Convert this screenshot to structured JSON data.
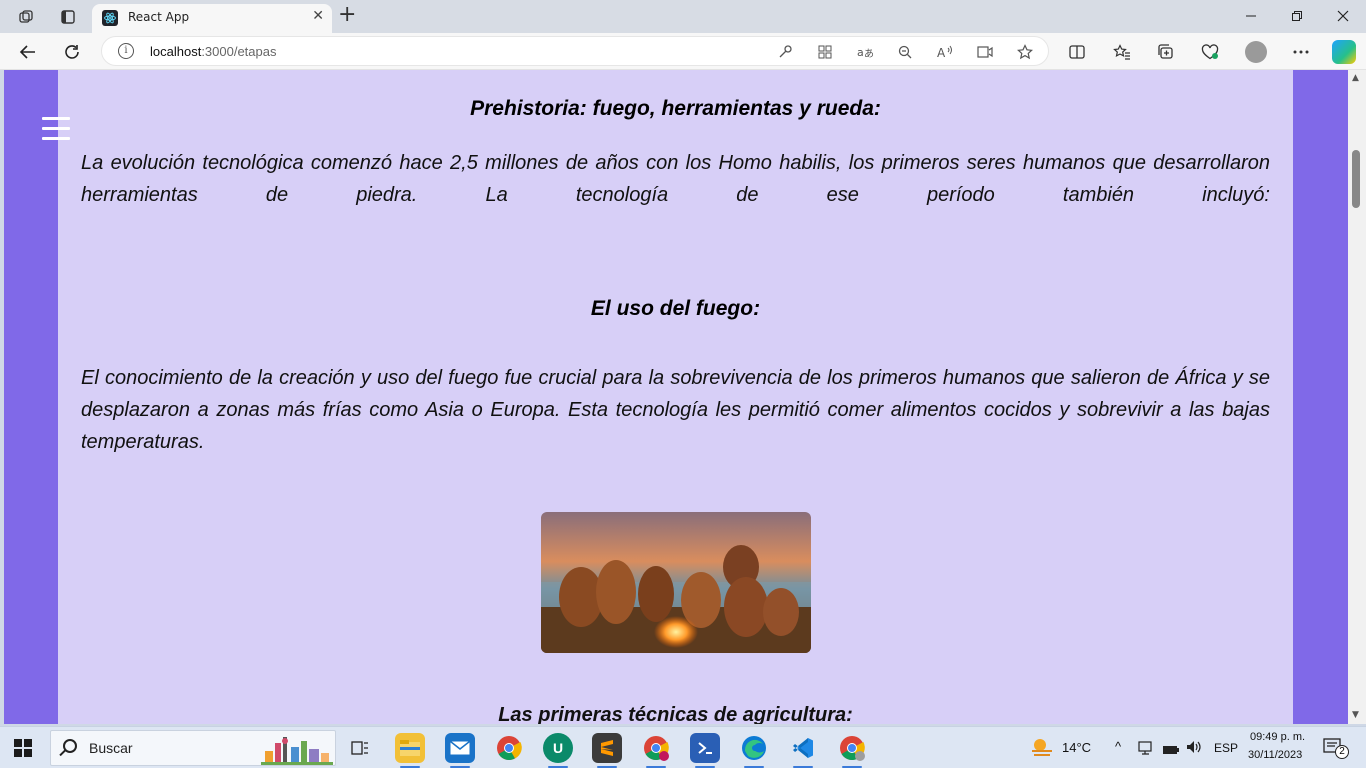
{
  "browser": {
    "tab_title": "React App",
    "new_tab_symbol": "+",
    "close_tab_symbol": "✕",
    "address_host": "localhost",
    "address_path": ":3000/etapas"
  },
  "page": {
    "heading": "Prehistoria: fuego, herramientas y rueda:",
    "intro": "La evolución tecnológica comenzó hace 2,5 millones de años con los Homo habilis, los primeros seres humanos que desarrollaron herramientas de piedra. La tecnología de ese período también incluyó:",
    "subheading_fire": "El uso del fuego:",
    "fire_text": "El conocimiento de la creación y uso del fuego fue crucial para la sobrevivencia de los primeros humanos que salieron de África y se desplazaron a zonas más frías como Asia o Europa. Esta tecnología les permitió comer alimentos cocidos y sobrevivir a las bajas temperaturas.",
    "next_heading": "Las primeras técnicas de agricultura:"
  },
  "taskbar": {
    "search_placeholder": "Buscar",
    "weather": "14°C",
    "language": "ESP",
    "time": "09:49 p. m.",
    "date": "30/11/2023",
    "notifications": "2"
  },
  "colors": {
    "sidebar": "#8069e8",
    "content_bg": "#d7cff7"
  }
}
